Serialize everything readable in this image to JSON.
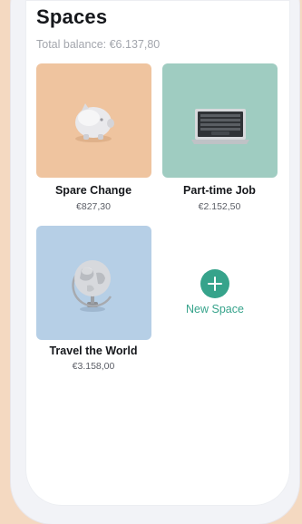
{
  "header": {
    "title": "Spaces",
    "total_balance": "Total balance: €6.137,80"
  },
  "spaces": [
    {
      "name": "Spare Change",
      "amount": "€827,30",
      "icon": "piggy-bank-icon",
      "color": "#efc49f"
    },
    {
      "name": "Part-time Job",
      "amount": "€2.152,50",
      "icon": "laptop-icon",
      "color": "#9fccc1"
    },
    {
      "name": "Travel the World",
      "amount": "€3.158,00",
      "icon": "globe-icon",
      "color": "#b6cfe6"
    }
  ],
  "new_space": {
    "label": "New Space",
    "icon": "plus-icon",
    "color": "#36a38b"
  }
}
